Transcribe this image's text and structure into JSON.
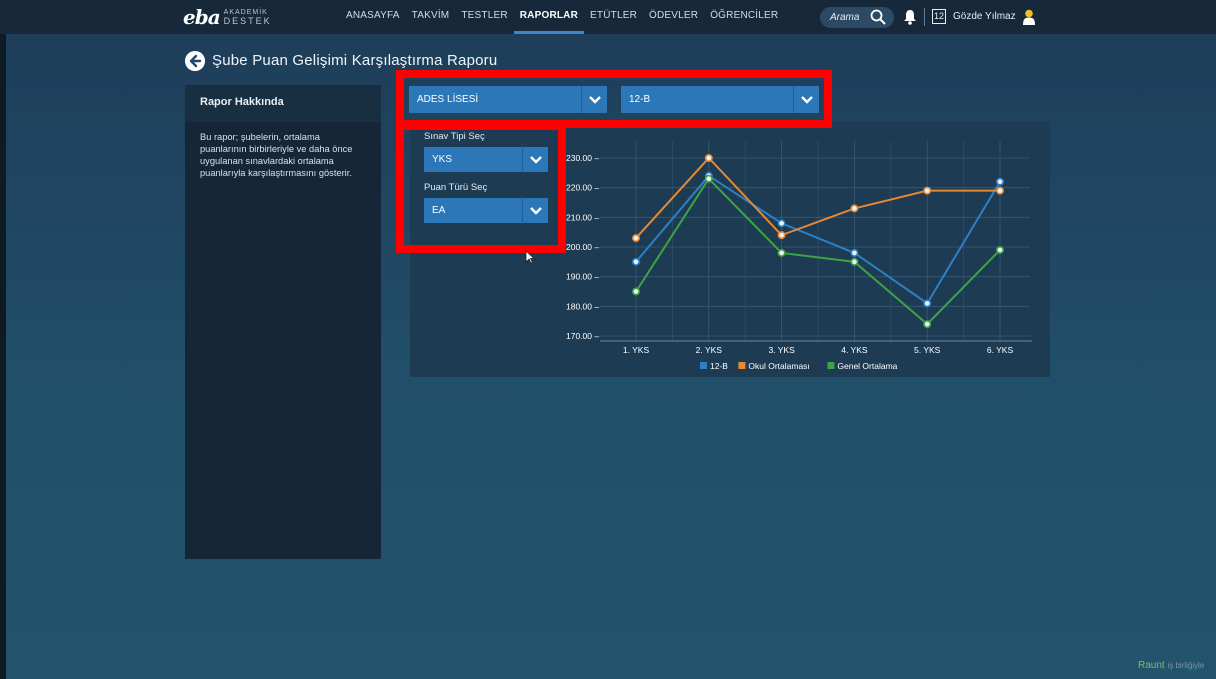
{
  "brand": {
    "logo_mark": "eba",
    "line1": "AKADEMİK",
    "line2": "DESTEK"
  },
  "nav": [
    {
      "label": "ANASAYFA",
      "active": false
    },
    {
      "label": "TAKVİM",
      "active": false
    },
    {
      "label": "TESTLER",
      "active": false
    },
    {
      "label": "RAPORLAR",
      "active": true
    },
    {
      "label": "ETÜTLER",
      "active": false
    },
    {
      "label": "ÖDEVLER",
      "active": false
    },
    {
      "label": "ÖĞRENCİLER",
      "active": false
    }
  ],
  "search": {
    "placeholder": "Arama",
    "icon": "search-icon"
  },
  "header_icons": {
    "notifications": "bell-icon",
    "calendar_day": "12",
    "user": "user-icon"
  },
  "user": {
    "name": "Gözde Yılmaz"
  },
  "page": {
    "title": "Şube Puan Gelişimi Karşılaştırma Raporu"
  },
  "info": {
    "heading": "Rapor Hakkında",
    "lines": [
      "Bu rapor; şubelerin, ortalama",
      "puanlarının birbirleriyle ve daha önce",
      "uygulanan sınavlardaki ortalama",
      "puanlarıyla karşılaştırmasını gösterir."
    ]
  },
  "filters": {
    "school": "ADES LİSESİ",
    "class": "12-B",
    "exam_type_label": "Sınav Tipi Seç",
    "exam_type": "YKS",
    "score_type_label": "Puan Türü Seç",
    "score_type": "EA"
  },
  "colors": {
    "accent": "#2b77b8",
    "highlight": "#ff0000",
    "series_12b": "#2e7fc7",
    "series_school": "#e8892f",
    "series_general": "#3da345"
  },
  "chart_data": {
    "type": "line",
    "categories": [
      "1. YKS",
      "2. YKS",
      "3. YKS",
      "4. YKS",
      "5. YKS",
      "6. YKS"
    ],
    "series": [
      {
        "name": "12-B",
        "values": [
          195,
          224,
          208,
          198,
          181,
          222
        ]
      },
      {
        "name": "Okul Ortalaması",
        "values": [
          203,
          230,
          204,
          213,
          219,
          219
        ]
      },
      {
        "name": "Genel Ortalama",
        "values": [
          185,
          223,
          198,
          195,
          174,
          199
        ]
      }
    ],
    "yticks": [
      "230.00",
      "220.00",
      "210.00",
      "200.00",
      "190.00",
      "180.00",
      "170.00"
    ],
    "ylim": [
      170,
      230
    ],
    "grid": true,
    "legend": "bottom"
  },
  "watermark": {
    "brand": "Raunt",
    "rest": "iş birliğiyle"
  }
}
